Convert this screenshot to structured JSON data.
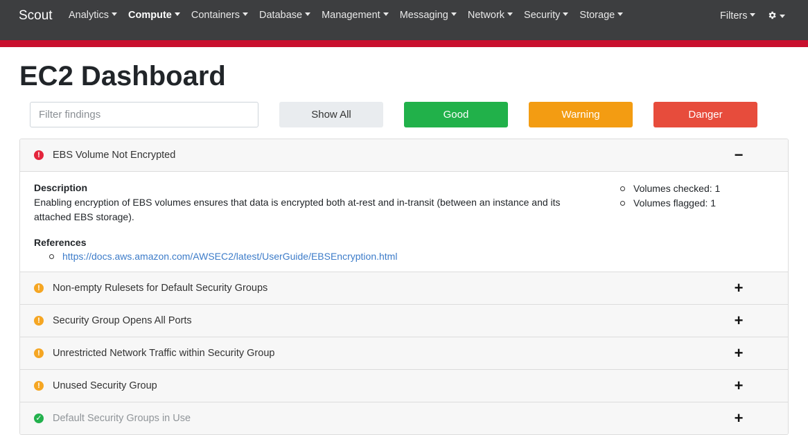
{
  "navbar": {
    "brand": "Scout",
    "menu": [
      {
        "label": "Analytics",
        "active": false
      },
      {
        "label": "Compute",
        "active": true
      },
      {
        "label": "Containers",
        "active": false
      },
      {
        "label": "Database",
        "active": false
      },
      {
        "label": "Management",
        "active": false
      },
      {
        "label": "Messaging",
        "active": false
      },
      {
        "label": "Network",
        "active": false
      },
      {
        "label": "Security",
        "active": false
      },
      {
        "label": "Storage",
        "active": false
      }
    ],
    "filters_label": "Filters",
    "settings_icon": "gear-icon"
  },
  "colors": {
    "navbar_bg": "#3d3e40",
    "accent_bar": "#c8102e",
    "good": "#21b14a",
    "warning": "#f39c12",
    "danger": "#e74c3c",
    "link": "#3d7cc9"
  },
  "page": {
    "title": "EC2 Dashboard",
    "filter_placeholder": "Filter findings",
    "buttons": {
      "show_all": "Show All",
      "good": "Good",
      "warning": "Warning",
      "danger": "Danger"
    }
  },
  "findings": [
    {
      "title": "EBS Volume Not Encrypted",
      "level": "danger",
      "expanded": true,
      "toggle": "−",
      "description_label": "Description",
      "description": "Enabling encryption of EBS volumes ensures that data is encrypted both at-rest and in-transit (between an instance and its attached EBS storage).",
      "references_label": "References",
      "references": [
        "https://docs.aws.amazon.com/AWSEC2/latest/UserGuide/EBSEncryption.html"
      ],
      "stats": [
        "Volumes checked: 1",
        "Volumes flagged: 1"
      ]
    },
    {
      "title": "Non-empty Rulesets for Default Security Groups",
      "level": "warning",
      "expanded": false,
      "toggle": "+"
    },
    {
      "title": "Security Group Opens All Ports",
      "level": "warning",
      "expanded": false,
      "toggle": "+"
    },
    {
      "title": "Unrestricted Network Traffic within Security Group",
      "level": "warning",
      "expanded": false,
      "toggle": "+"
    },
    {
      "title": "Unused Security Group",
      "level": "warning",
      "expanded": false,
      "toggle": "+"
    },
    {
      "title": "Default Security Groups in Use",
      "level": "good",
      "expanded": false,
      "toggle": "+"
    }
  ]
}
